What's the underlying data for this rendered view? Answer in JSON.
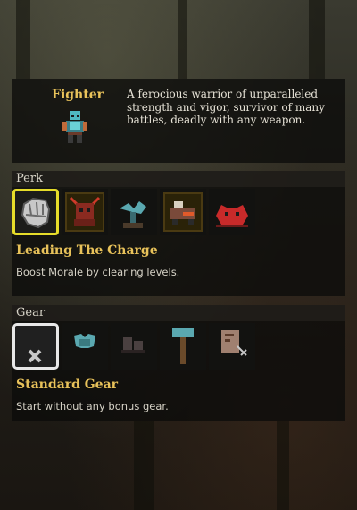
{
  "class": {
    "name": "Fighter",
    "description": "A ferocious warrior of unparalleled strength and vigor, survivor of many battles, deadly with any weapon."
  },
  "perk": {
    "header": "Perk",
    "selected_index": 0,
    "items": [
      "gauntlet-icon",
      "horned-helm-icon",
      "plant-icon",
      "fire-wagon-icon",
      "red-crab-icon"
    ],
    "selected_name": "Leading The Charge",
    "selected_desc": "Boost Morale by clearing levels."
  },
  "gear": {
    "header": "Gear",
    "selected_index": 0,
    "items": [
      "x-mark-icon",
      "armor-icon",
      "boots-icon",
      "hammer-icon",
      "scroll-icon"
    ],
    "selected_name": "Standard Gear",
    "selected_desc": "Start without any bonus gear."
  },
  "colors": {
    "gold": "#e8c25a",
    "perk_highlight": "#e6dc2a",
    "gear_highlight": "#e8e8e8"
  }
}
